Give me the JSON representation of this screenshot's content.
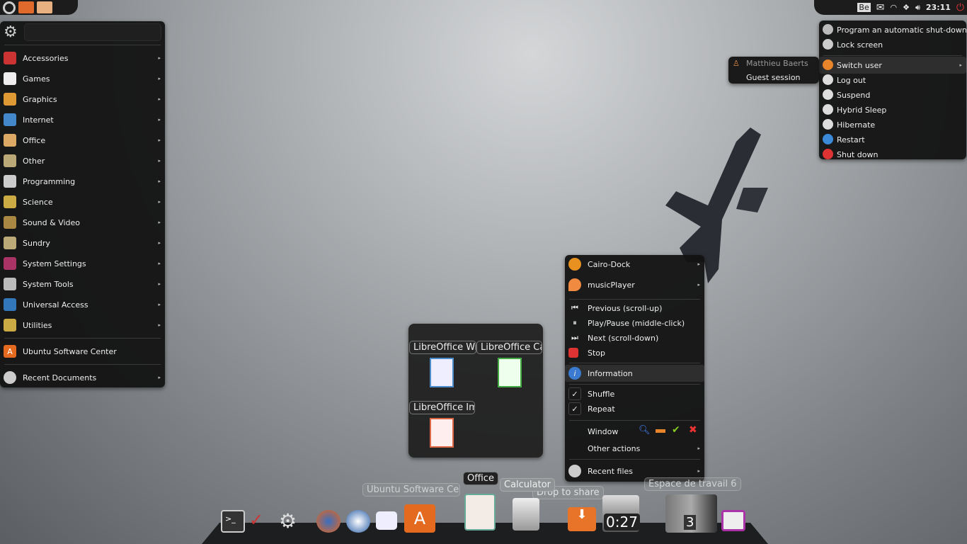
{
  "top_left_panel": {
    "icons": [
      "ubuntu-logo-icon",
      "home-folder-icon",
      "documents-folder-icon"
    ]
  },
  "app_menu": {
    "search_placeholder": "",
    "items": [
      {
        "label": "Accessories",
        "icon": "knife-icon",
        "color": "#c33"
      },
      {
        "label": "Games",
        "icon": "cards-icon",
        "color": "#eee"
      },
      {
        "label": "Graphics",
        "icon": "brush-icon",
        "color": "#d93"
      },
      {
        "label": "Internet",
        "icon": "globe-icon",
        "color": "#48c"
      },
      {
        "label": "Office",
        "icon": "office-icon",
        "color": "#da6"
      },
      {
        "label": "Other",
        "icon": "box-icon",
        "color": "#ba7"
      },
      {
        "label": "Programming",
        "icon": "pen-icon",
        "color": "#ccc"
      },
      {
        "label": "Science",
        "icon": "flask-icon",
        "color": "#ca4"
      },
      {
        "label": "Sound & Video",
        "icon": "film-icon",
        "color": "#a84"
      },
      {
        "label": "Sundry",
        "icon": "box-icon",
        "color": "#ba7"
      },
      {
        "label": "System Settings",
        "icon": "settings-icon",
        "color": "#a36"
      },
      {
        "label": "System Tools",
        "icon": "gear-icon",
        "color": "#bbb"
      },
      {
        "label": "Universal Access",
        "icon": "accessibility-icon",
        "color": "#37b"
      },
      {
        "label": "Utilities",
        "icon": "utilities-icon",
        "color": "#ca4"
      }
    ],
    "software_center": "Ubuntu Software Center",
    "recent": "Recent Documents"
  },
  "tray": {
    "items": [
      "Be",
      "mail-icon",
      "wifi-icon",
      "dropbox-icon",
      "volume-icon"
    ],
    "clock": "23:11"
  },
  "session_menu": {
    "items": [
      {
        "label": "Program an automatic shut-down",
        "icon": "timer-icon"
      },
      {
        "label": "Lock screen",
        "icon": "lock-screen-icon"
      },
      {
        "label": "Switch user",
        "icon": "switch-user-icon",
        "submenu": true
      },
      {
        "label": "Log out",
        "icon": "logout-icon"
      },
      {
        "label": "Suspend",
        "icon": "clock-icon"
      },
      {
        "label": "Hybrid Sleep",
        "icon": "clock-icon"
      },
      {
        "label": "Hibernate",
        "icon": "clock-icon"
      },
      {
        "label": "Restart",
        "icon": "restart-icon"
      },
      {
        "label": "Shut down",
        "icon": "power-icon"
      }
    ],
    "users": [
      "Matthieu Baerts",
      "Guest session"
    ]
  },
  "office_popup": {
    "apps": [
      "LibreOffice Writer",
      "LibreOffice Calc",
      "LibreOffice Impress"
    ]
  },
  "music_menu": {
    "cairo_dock": "Cairo-Dock",
    "player": "musicPlayer",
    "previous": "Previous (scroll-up)",
    "playpause": "Play/Pause (middle-click)",
    "next": "Next (scroll-down)",
    "stop": "Stop",
    "information": "Information",
    "shuffle": "Shuffle",
    "repeat": "Repeat",
    "window": "Window",
    "other": "Other actions",
    "recent": "Recent files"
  },
  "dock": {
    "labels": {
      "software": "Ubuntu Software Center",
      "office": "Office",
      "calculator": "Calculator",
      "share": "Drop to share",
      "workspace": "Espace de travail 6"
    },
    "timer": "0:27",
    "workspace_num": "3"
  }
}
